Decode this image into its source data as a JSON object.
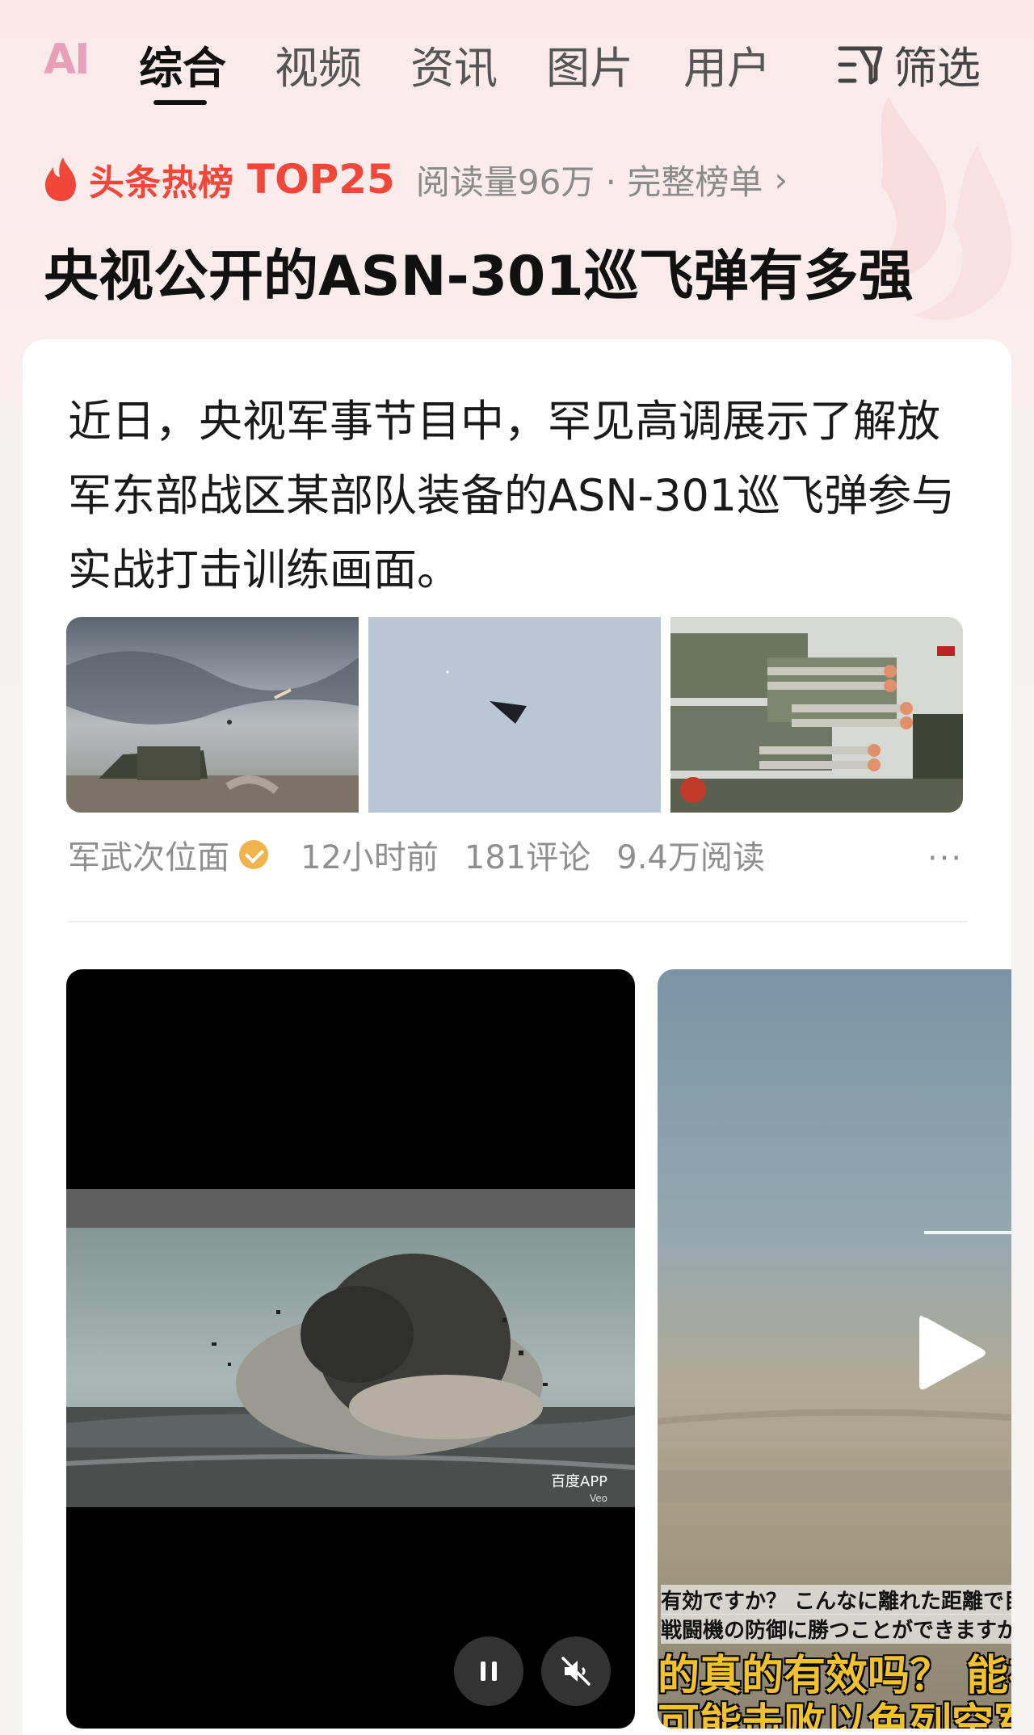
{
  "tabs": {
    "ai_label": "AI",
    "items": [
      {
        "label": "综合",
        "active": true
      },
      {
        "label": "视频",
        "active": false
      },
      {
        "label": "资讯",
        "active": false
      },
      {
        "label": "图片",
        "active": false
      },
      {
        "label": "用户",
        "active": false
      }
    ],
    "filter_label": "筛选"
  },
  "hotlist": {
    "brand": "头条热榜",
    "rank": "TOP25",
    "meta": "阅读量96万 · 完整榜单",
    "chevron": "›"
  },
  "headline": "央视公开的ASN-301巡飞弹有多强",
  "article": {
    "text": "近日，央视军事节目中，罕见高调展示了解放军东部战区某部队装备的ASN-301巡飞弹参与实战打击训练画面。",
    "thumbnails": [
      {
        "name": "launcher-vehicle-image"
      },
      {
        "name": "drone-in-sky-image"
      },
      {
        "name": "parade-missiles-image"
      }
    ],
    "author": "军武次位面",
    "time": "12小时前",
    "comments": "181评论",
    "reads": "9.4万阅读",
    "more": "···"
  },
  "videos": {
    "main_watermark": "百度APP",
    "main_watermark_sub": "Veo",
    "side_subtitle_1": "有効ですか？ こんなに離れた距離で目",
    "side_subtitle_2": "戦闘機の防御に勝つことができますか",
    "side_subtitle_3": "的真的有效吗？ 能在远",
    "side_subtitle_4": "可能击败以色列空军"
  },
  "colors": {
    "accent": "#f0473a",
    "meta_gray": "#8f8f8f",
    "badge_orange": "#f0b24a"
  }
}
